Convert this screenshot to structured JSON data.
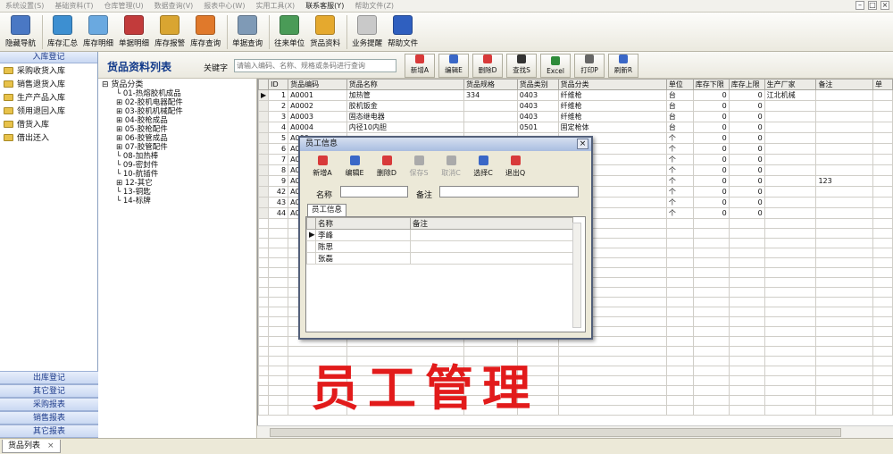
{
  "menu": {
    "items": [
      "系统设置(S)",
      "基础资料(T)",
      "仓库管理(U)",
      "数据查询(V)",
      "报表中心(W)",
      "实用工具(X)",
      "联系客服(Y)",
      "帮助文件(Z)"
    ],
    "active_index": 6
  },
  "toolbar": {
    "buttons": [
      {
        "label": "隐藏导航",
        "icon": "hide-nav-icon",
        "color": "#4a78c4"
      },
      {
        "label": "库存汇总",
        "icon": "stock-summary-icon",
        "color": "#3d8fd1"
      },
      {
        "label": "库存明细",
        "icon": "stock-detail-icon",
        "color": "#6aa9e0"
      },
      {
        "label": "单据明细",
        "icon": "doc-detail-icon",
        "color": "#c23b3b"
      },
      {
        "label": "库存报警",
        "icon": "stock-alarm-icon",
        "color": "#d9a531"
      },
      {
        "label": "库存查询",
        "icon": "stock-query-icon",
        "color": "#e0792b"
      },
      {
        "label": "单据查询",
        "icon": "doc-query-icon",
        "color": "#7f9ab6"
      },
      {
        "label": "往来单位",
        "icon": "partner-icon",
        "color": "#4a9b57"
      },
      {
        "label": "货品资料",
        "icon": "goods-icon",
        "color": "#e5a92e"
      },
      {
        "label": "业务提醒",
        "icon": "calendar-icon",
        "color": "#c9c9c9"
      },
      {
        "label": "帮助文件",
        "icon": "help-icon",
        "color": "#2f5fbf"
      }
    ]
  },
  "sidebar": {
    "top_header": "入库登记",
    "items": [
      "采购收货入库",
      "销售退货入库",
      "生产产品入库",
      "领用退回入库",
      "借货入库",
      "借出还入"
    ],
    "bottom_headers": [
      "出库登记",
      "其它登记",
      "采购报表",
      "销售报表",
      "其它报表"
    ]
  },
  "main": {
    "title": "货品资料列表",
    "keyword_label": "关键字",
    "keyword_placeholder": "请输入编码、名称、规格或条码进行查询",
    "actions": [
      {
        "label": "新增A",
        "icon": "add-icon",
        "color": "#d83a3a"
      },
      {
        "label": "编辑E",
        "icon": "edit-icon",
        "color": "#3a67c7"
      },
      {
        "label": "删除D",
        "icon": "delete-icon",
        "color": "#d83a3a"
      },
      {
        "label": "查找S",
        "icon": "binoculars-icon",
        "color": "#333333"
      },
      {
        "label": "Excel",
        "icon": "excel-icon",
        "color": "#2e8b3a"
      },
      {
        "label": "打印P",
        "icon": "print-icon",
        "color": "#666666"
      },
      {
        "label": "刷新R",
        "icon": "refresh-icon",
        "color": "#3a67c7"
      }
    ]
  },
  "tree": {
    "root": "货品分类",
    "nodes": [
      "01-热熔胶机成品",
      "02-胶机电器配件",
      "03-胶机机械配件",
      "04-胶枪成品",
      "05-胶枪配件",
      "06-胶管成品",
      "07-胶管配件",
      "08-加热棒",
      "09-密封件",
      "10-航插件",
      "12-其它",
      "13-铜匙",
      "14-标牌"
    ]
  },
  "grid": {
    "columns": [
      "ID",
      "货品编码",
      "货品名称",
      "货品规格",
      "货品类别",
      "货品分类",
      "单位",
      "库存下限",
      "库存上限",
      "生产厂家",
      "备注",
      "单"
    ],
    "rows": [
      [
        "1",
        "A0001",
        "加热管",
        "334",
        "0403",
        "纤维枪",
        "台",
        "0",
        "0",
        "江北机械",
        ""
      ],
      [
        "2",
        "A0002",
        "胶机钣金",
        "",
        "0403",
        "纤维枪",
        "台",
        "0",
        "0",
        "",
        ""
      ],
      [
        "3",
        "A0003",
        "固态继电器",
        "",
        "0403",
        "纤维枪",
        "台",
        "0",
        "0",
        "",
        ""
      ],
      [
        "4",
        "A0004",
        "内径10内胆",
        "",
        "0501",
        "固定枪体",
        "台",
        "0",
        "0",
        "",
        ""
      ],
      [
        "5",
        "A000",
        "",
        "",
        "",
        "",
        "个",
        "0",
        "0",
        "",
        ""
      ],
      [
        "6",
        "A000",
        "",
        "",
        "",
        "",
        "个",
        "0",
        "0",
        "",
        ""
      ],
      [
        "7",
        "A000",
        "",
        "",
        "",
        "",
        "个",
        "0",
        "0",
        "",
        ""
      ],
      [
        "8",
        "A000",
        "",
        "",
        "",
        "",
        "个",
        "0",
        "0",
        "",
        ""
      ],
      [
        "9",
        "A000",
        "",
        "",
        "",
        "",
        "个",
        "0",
        "0",
        "",
        "123"
      ],
      [
        "42",
        "A000",
        "",
        "",
        "",
        "",
        "个",
        "0",
        "0",
        "",
        ""
      ],
      [
        "43",
        "A000",
        "",
        "",
        "",
        "",
        "个",
        "0",
        "0",
        "",
        ""
      ],
      [
        "44",
        "A000",
        "",
        "",
        "",
        "",
        "个",
        "0",
        "0",
        "",
        ""
      ]
    ]
  },
  "statusbar": {
    "tab_label": "货品列表",
    "tab_close": "×"
  },
  "dialog": {
    "title": "员工信息",
    "close": "×",
    "buttons": [
      {
        "label": "新增A",
        "icon": "add-icon",
        "color": "#d83a3a",
        "disabled": false
      },
      {
        "label": "编辑E",
        "icon": "edit-icon",
        "color": "#3a67c7",
        "disabled": false
      },
      {
        "label": "删除D",
        "icon": "delete-icon",
        "color": "#d83a3a",
        "disabled": false
      },
      {
        "label": "保存S",
        "icon": "save-icon",
        "color": "#aaaaaa",
        "disabled": true
      },
      {
        "label": "取消C",
        "icon": "cancel-icon",
        "color": "#aaaaaa",
        "disabled": true
      },
      {
        "label": "选择C",
        "icon": "select-icon",
        "color": "#3a67c7",
        "disabled": false
      },
      {
        "label": "退出Q",
        "icon": "exit-icon",
        "color": "#d83a3a",
        "disabled": false
      }
    ],
    "name_label": "名称",
    "note_label": "备注",
    "tab_label": "员工信息",
    "columns": [
      "名称",
      "备注"
    ],
    "rows": [
      [
        "李峰",
        ""
      ],
      [
        "陈思",
        ""
      ],
      [
        "张磊",
        ""
      ]
    ]
  },
  "overlay_text": "员工管理"
}
